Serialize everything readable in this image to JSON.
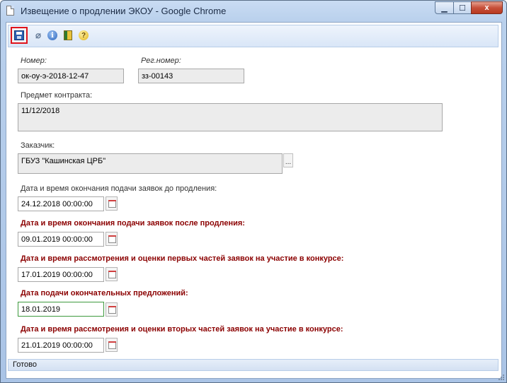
{
  "window": {
    "title": "Извещение о продлении ЭКОУ - Google Chrome",
    "close_glyph": "x",
    "min_glyph": "▁",
    "max_glyph": "☐"
  },
  "toolbar": {
    "icons": [
      "save-icon",
      "attach-icon",
      "info-icon",
      "book-icon",
      "help-icon"
    ],
    "clip_glyph": "⌀",
    "info_glyph": "i",
    "help_glyph": "?"
  },
  "form": {
    "number": {
      "label": "Номер:",
      "value": "ок-оу-э-2018-12-47"
    },
    "reg_number": {
      "label": "Рег.номер:",
      "value": "зз-00143"
    },
    "subject": {
      "label": "Предмет контракта:",
      "value": "11/12/2018"
    },
    "customer": {
      "label": "Заказчик:",
      "value": "ГБУЗ \"Кашинская ЦРБ\"",
      "button": "..."
    },
    "deadline_before": {
      "label": "Дата и время окончания подачи заявок до продления:",
      "value": "24.12.2018 00:00:00"
    },
    "deadline_after": {
      "label": "Дата и время окончания подачи заявок после продления:",
      "value": "09.01.2019 00:00:00"
    },
    "first_parts": {
      "label": "Дата и время рассмотрения и оценки первых частей заявок на участие в конкурсе:",
      "value": "17.01.2019 00:00:00"
    },
    "final_offers": {
      "label": "Дата подачи окончательных предложений:",
      "value": "18.01.2019"
    },
    "second_parts": {
      "label": "Дата и время рассмотрения и оценки вторых частей заявок на участие в конкурсе:",
      "value": "21.01.2019 00:00:00"
    }
  },
  "status": {
    "text": "Готово"
  },
  "colors": {
    "required_label": "#8b0000",
    "save_highlight": "#e0141c",
    "active_field_border": "#3e9a3e"
  }
}
